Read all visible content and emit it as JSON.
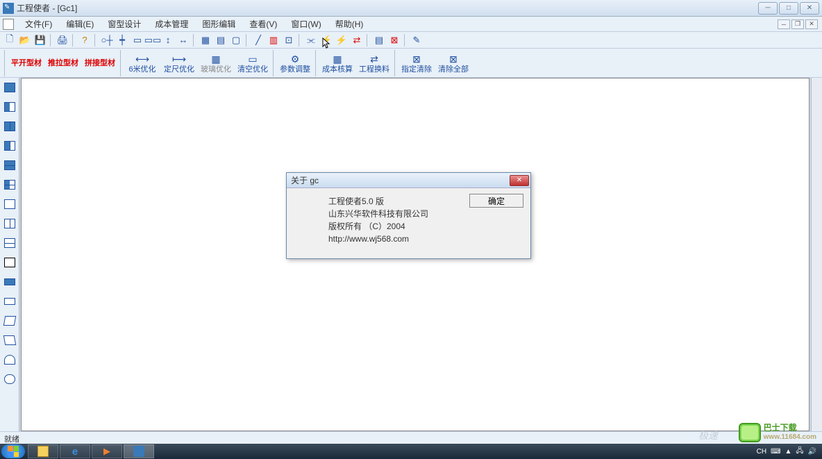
{
  "title": "工程使者 - [Gc1]",
  "menu": [
    "文件(F)",
    "编辑(E)",
    "窗型设计",
    "成本管理",
    "图形编辑",
    "查看(V)",
    "窗口(W)",
    "帮助(H)"
  ],
  "toolbar2": [
    {
      "label": "平开型材",
      "cls": "red"
    },
    {
      "label": "推拉型材",
      "cls": "red"
    },
    {
      "label": "拼接型材",
      "cls": "red"
    },
    {
      "label": "6米优化",
      "cls": "blue"
    },
    {
      "label": "定尺优化",
      "cls": "blue"
    },
    {
      "label": "玻璃优化",
      "cls": "gray"
    },
    {
      "label": "清空优化",
      "cls": "blue"
    },
    {
      "label": "参数调整",
      "cls": "blue"
    },
    {
      "label": "成本核算",
      "cls": "blue"
    },
    {
      "label": "工程换料",
      "cls": "blue"
    },
    {
      "label": "指定清除",
      "cls": "blue"
    },
    {
      "label": "清除全部",
      "cls": "blue"
    }
  ],
  "dialog": {
    "title": "关于 gc",
    "line1": "工程使者5.0 版",
    "line2": "山东兴华软件科技有限公司",
    "line3": "版权所有 （C）2004",
    "line4": "http://www.wj568.com",
    "ok": "确定"
  },
  "status": "就绪",
  "tray": {
    "ime": "CH",
    "watermark_top": "巴士下载",
    "watermark_bottom": "www.11684.com",
    "fade": "极速"
  }
}
